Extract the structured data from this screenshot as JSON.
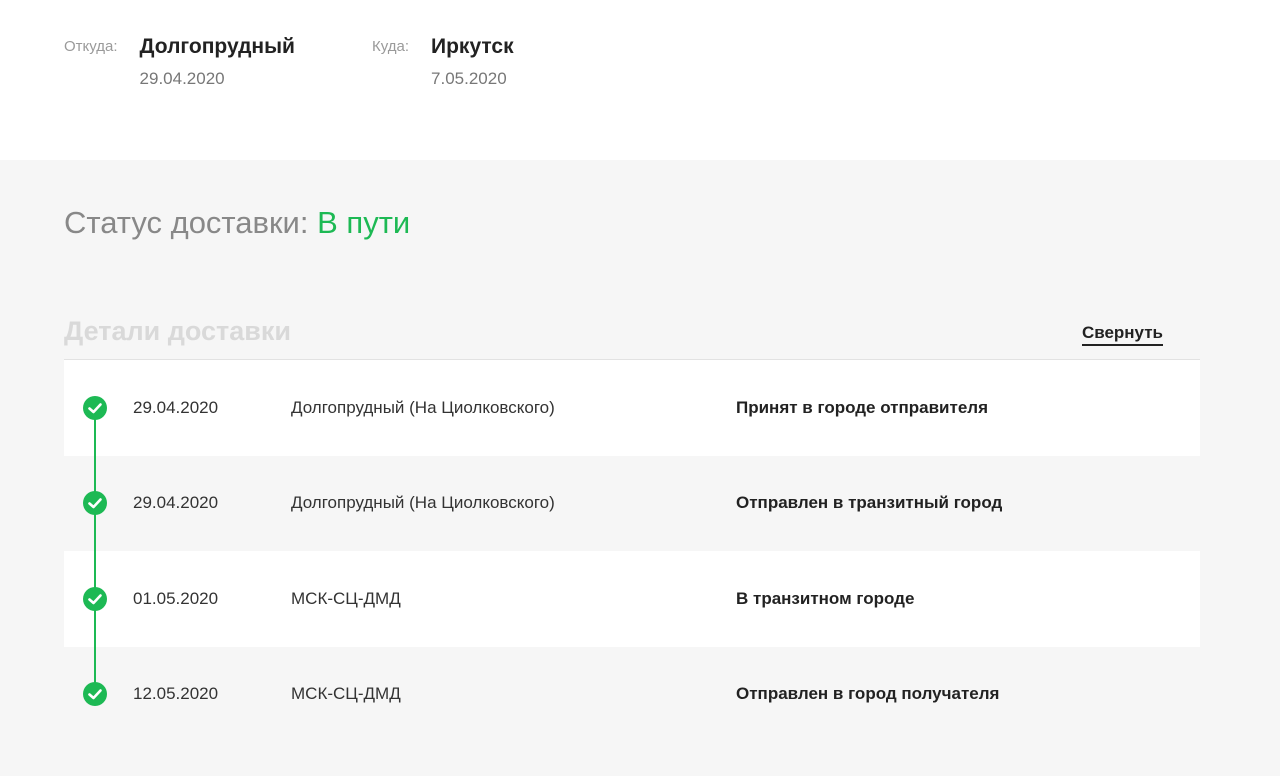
{
  "route": {
    "from_label": "Откуда:",
    "from_city": "Долгопрудный",
    "from_date": "29.04.2020",
    "to_label": "Куда:",
    "to_city": "Иркутск",
    "to_date": "7.05.2020"
  },
  "status": {
    "label": "Статус доставки:",
    "value": "В пути"
  },
  "details": {
    "title": "Детали доставки",
    "collapse_label": "Свернуть",
    "events": [
      {
        "date": "29.04.2020",
        "place": "Долгопрудный (На Циолковского)",
        "status": "Принят в городе отправителя",
        "icon": "check-circle-icon"
      },
      {
        "date": "29.04.2020",
        "place": "Долгопрудный (На Циолковского)",
        "status": "Отправлен в транзитный город",
        "icon": "check-circle-icon"
      },
      {
        "date": "01.05.2020",
        "place": "МСК-СЦ-ДМД",
        "status": "В транзитном городе",
        "icon": "check-circle-icon"
      },
      {
        "date": "12.05.2020",
        "place": "МСК-СЦ-ДМД",
        "status": "Отправлен в город получателя",
        "icon": "check-circle-icon"
      }
    ]
  },
  "colors": {
    "accent_green": "#1db954",
    "muted_text": "#9a9a9a",
    "section_bg": "#f6f6f6"
  }
}
